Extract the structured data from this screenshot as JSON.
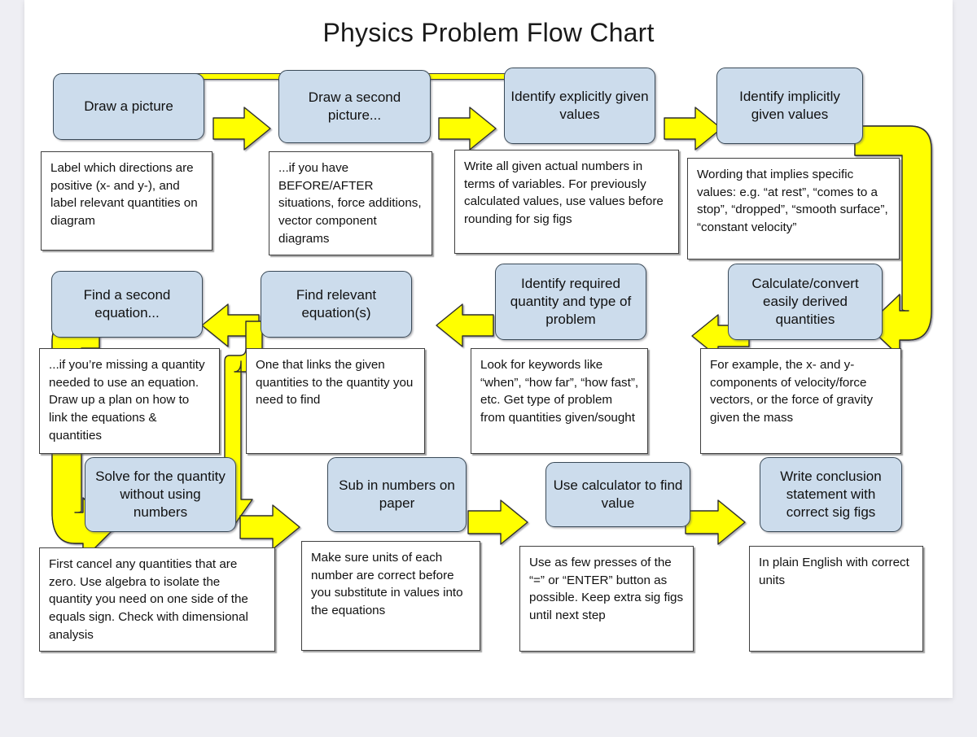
{
  "title": "Physics Problem Flow Chart",
  "colors": {
    "process_fill": "#ccdcec",
    "process_stroke": "#3a4a58",
    "note_fill": "#ffffff",
    "note_stroke": "#3f3f3f",
    "arrow_fill": "#ffff00",
    "arrow_stroke": "#3a4a58",
    "page_background": "#eeeef3",
    "card_background": "#ffffff"
  },
  "chart_data": {
    "type": "diagram",
    "diagram_kind": "flowchart",
    "title": "Physics Problem Flow Chart",
    "nodes": [
      {
        "id": "n1",
        "label": "Draw a picture",
        "note": "Label which directions are positive (x- and y-), and label relevant quantities on diagram"
      },
      {
        "id": "n2",
        "label": "Draw a second picture...",
        "note": "...if you have BEFORE/AFTER situations, force additions, vector component diagrams"
      },
      {
        "id": "n3",
        "label": "Identify explicitly given values",
        "note": "Write all given actual numbers in terms of variables. For previously calculated values, use values before rounding for sig figs"
      },
      {
        "id": "n4",
        "label": "Identify implicitly given values",
        "note": "Wording that implies specific values: e.g. “at rest”, “comes to a stop”, “dropped”, “smooth surface”, “constant velocity”"
      },
      {
        "id": "n5",
        "label": "Find a second equation...",
        "note": "...if you’re missing a quantity needed to use an equation. Draw up a plan on how to link the equations & quantities"
      },
      {
        "id": "n6",
        "label": "Find relevant equation(s)",
        "note": "One that links the given quantities to the quantity you need to find"
      },
      {
        "id": "n7",
        "label": "Identify required quantity and type of problem",
        "note": "Look for keywords like “when”, “how far”, “how fast”, etc. Get type of problem from quantities given/sought"
      },
      {
        "id": "n8",
        "label": "Calculate/convert easily derived quantities",
        "note": "For example, the x- and y-components of velocity/force vectors, or the force of gravity given the mass"
      },
      {
        "id": "n9",
        "label": "Solve for the quantity without using numbers",
        "note": "First cancel any quantities that are zero. Use algebra to isolate the quantity you need on one side of the equals sign. Check with dimensional analysis"
      },
      {
        "id": "n10",
        "label": "Sub in numbers on paper",
        "note": "Make sure units of each number are correct before you substitute in values into the equations"
      },
      {
        "id": "n11",
        "label": "Use calculator to find value",
        "note": "Use as few presses of the “=” or “ENTER” button as possible. Keep extra sig figs until next step"
      },
      {
        "id": "n12",
        "label": "Write conclusion statement with correct sig figs",
        "note": "In plain English with correct units"
      }
    ],
    "edges": [
      {
        "from": "n1",
        "to": "n2",
        "style": "block-arrow",
        "direction": "right"
      },
      {
        "from": "n2",
        "to": "n3",
        "style": "block-arrow",
        "direction": "right"
      },
      {
        "from": "n3",
        "to": "n4",
        "style": "block-arrow",
        "direction": "right"
      },
      {
        "from": "n1",
        "to": "n3",
        "style": "thin-bracket",
        "direction": "over-top"
      },
      {
        "from": "n4",
        "to": "n8",
        "style": "thick-u-turn",
        "direction": "right-down-left"
      },
      {
        "from": "n8",
        "to": "n7",
        "style": "block-arrow",
        "direction": "left"
      },
      {
        "from": "n7",
        "to": "n6",
        "style": "block-arrow",
        "direction": "left"
      },
      {
        "from": "n6",
        "to": "n5",
        "style": "block-arrow",
        "direction": "left"
      },
      {
        "from": "n5",
        "to": "n9",
        "style": "thick-u-turn",
        "direction": "left-down-right"
      },
      {
        "from": "n6",
        "to": "n9",
        "style": "elbow-down",
        "direction": "down"
      },
      {
        "from": "n9",
        "to": "n10",
        "style": "block-arrow",
        "direction": "right"
      },
      {
        "from": "n10",
        "to": "n11",
        "style": "block-arrow",
        "direction": "right"
      },
      {
        "from": "n11",
        "to": "n12",
        "style": "block-arrow",
        "direction": "right"
      }
    ]
  },
  "boxes": {
    "n1_label": "Draw a picture",
    "n2_label": "Draw a second picture...",
    "n3_label": "Identify explicitly given values",
    "n4_label": "Identify implicitly given values",
    "n5_label": "Find a second equation...",
    "n6_label": "Find relevant equation(s)",
    "n7_label": "Identify required quantity and type of problem",
    "n8_label": "Calculate/convert easily derived quantities",
    "n9_label": "Solve for the quantity without using numbers",
    "n10_label": "Sub in numbers on paper",
    "n11_label": "Use calculator to find value",
    "n12_label": "Write conclusion statement with correct sig figs"
  },
  "notes": {
    "n1_note": "Label which directions are positive (x- and y-), and label relevant quantities on diagram",
    "n2_note": "...if you have BEFORE/AFTER situations, force additions, vector component diagrams",
    "n3_note": "Write all given actual numbers in terms of variables. For previously calculated values, use values before rounding for sig figs",
    "n4_note": "Wording that implies specific values: e.g. “at rest”, “comes to a stop”, “dropped”, “smooth surface”, “constant velocity”",
    "n5_note": "...if you’re missing a quantity needed to use an equation. Draw up a plan on how to link the equations & quantities",
    "n6_note": "One that links the given quantities to the quantity you need to find",
    "n7_note": "Look for keywords like “when”, “how far”, “how fast”, etc. Get type of problem from quantities given/sought",
    "n8_note": "For example, the x- and y-components of velocity/force vectors, or the force of gravity given the mass",
    "n9_note": "First cancel any quantities that are zero. Use algebra to isolate the quantity you need on one side of the equals sign. Check with dimensional analysis",
    "n10_note": "Make sure units of each number are correct before you substitute in values into the equations",
    "n11_note": "Use as few presses of the “=” or “ENTER” button as possible. Keep extra sig figs until next step",
    "n12_note": "In plain English with correct units"
  }
}
